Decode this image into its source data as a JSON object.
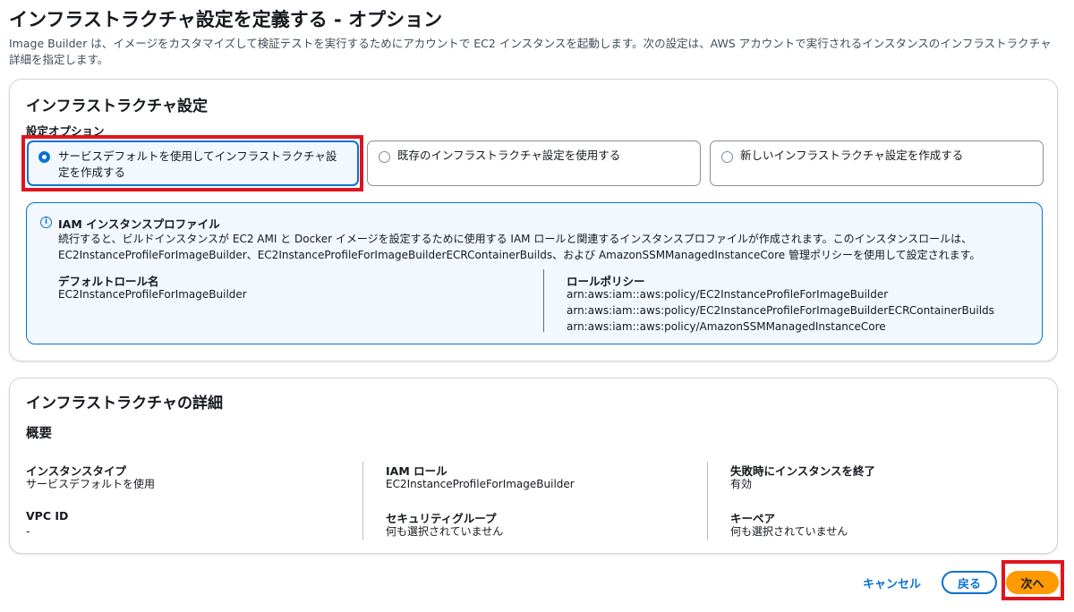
{
  "page": {
    "title": "インフラストラクチャ設定を定義する - オプション",
    "description": "Image Builder は、イメージをカスタマイズして検証テストを実行するためにアカウントで EC2 インスタンスを起動します。次の設定は、AWS アカウントで実行されるインスタンスのインフラストラクチャ詳細を指定します。"
  },
  "infra_settings": {
    "title": "インフラストラクチャ設定",
    "option_label": "設定オプション",
    "options": [
      {
        "label": "サービスデフォルトを使用してインフラストラクチャ設定を作成する",
        "selected": true
      },
      {
        "label": "既存のインフラストラクチャ設定を使用する",
        "selected": false
      },
      {
        "label": "新しいインフラストラクチャ設定を作成する",
        "selected": false
      }
    ],
    "info": {
      "icon": "info-circle-icon",
      "title": "IAM インスタンスプロファイル",
      "body": "続行すると、ビルドインスタンスが EC2 AMI と Docker イメージを設定するために使用する IAM ロールと関連するインスタンスプロファイルが作成されます。このインスタンスロールは、EC2InstanceProfileForImageBuilder、EC2InstanceProfileForImageBuilderECRContainerBuilds、および AmazonSSMManagedInstanceCore 管理ポリシーを使用して設定されます。",
      "default_role_label": "デフォルトロール名",
      "default_role_value": "EC2InstanceProfileForImageBuilder",
      "role_policy_label": "ロールポリシー",
      "role_policies": [
        "arn:aws:iam::aws:policy/EC2InstanceProfileForImageBuilder",
        "arn:aws:iam::aws:policy/EC2InstanceProfileForImageBuilderECRContainerBuilds",
        "arn:aws:iam::aws:policy/AmazonSSMManagedInstanceCore"
      ]
    }
  },
  "infra_details": {
    "title": "インフラストラクチャの詳細",
    "subheading": "概要",
    "fields": [
      {
        "label": "インスタンスタイプ",
        "value": "サービスデフォルトを使用"
      },
      {
        "label": "IAM ロール",
        "value": "EC2InstanceProfileForImageBuilder"
      },
      {
        "label": "失敗時にインスタンスを終了",
        "value": "有効"
      },
      {
        "label": "VPC ID",
        "value": "-"
      },
      {
        "label": "セキュリティグループ",
        "value": "何も選択されていません"
      },
      {
        "label": "キーペア",
        "value": "何も選択されていません"
      }
    ]
  },
  "footer": {
    "cancel_label": "キャンセル",
    "back_label": "戻る",
    "next_label": "次へ"
  },
  "colors": {
    "accent": "#0972d3",
    "primary_button": "#ff9900",
    "highlight": "#e0141e"
  }
}
